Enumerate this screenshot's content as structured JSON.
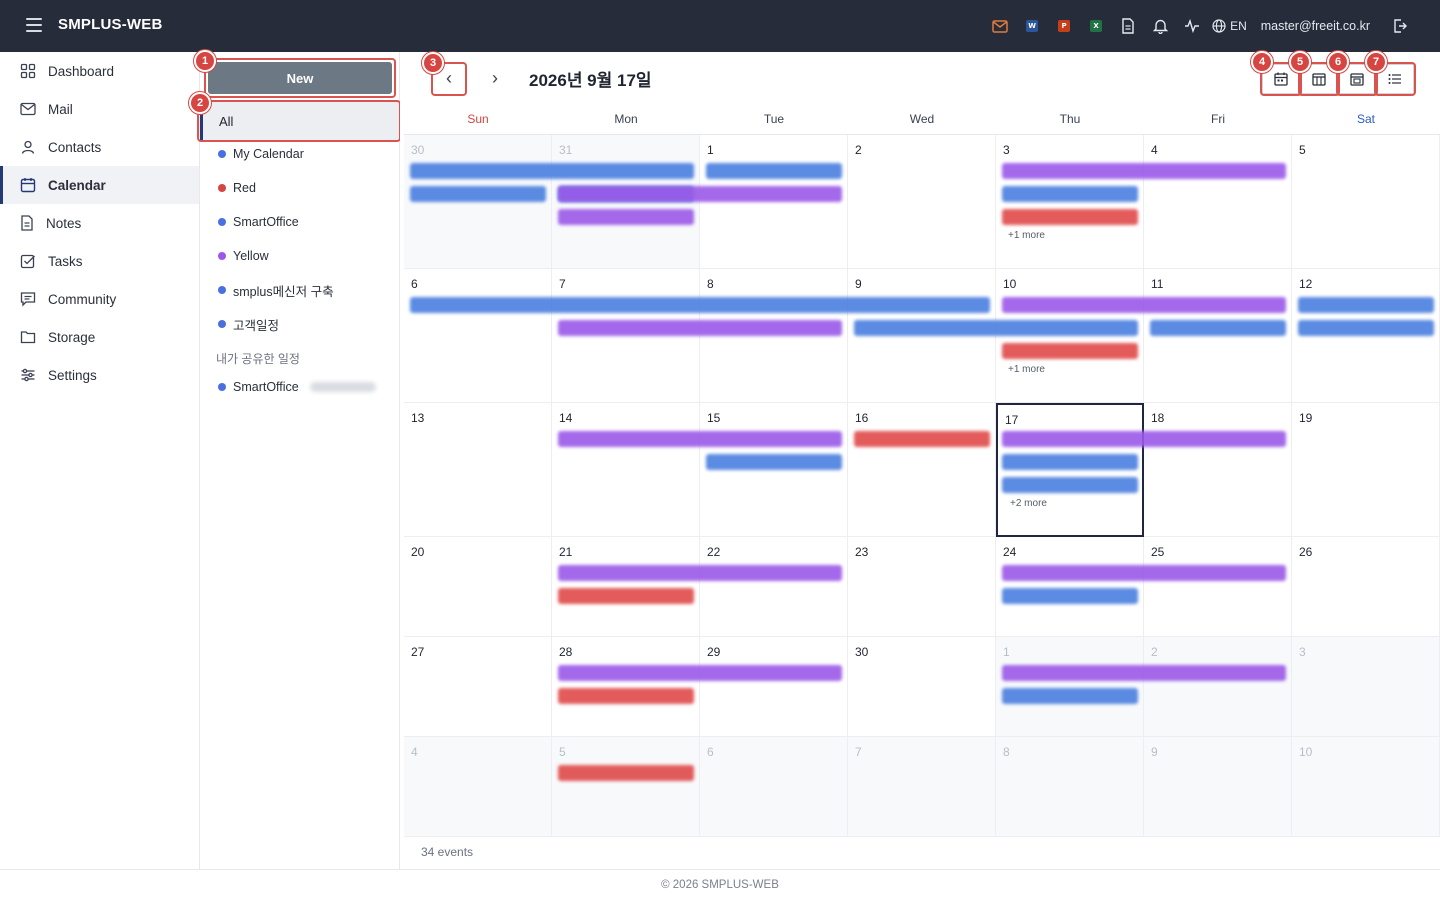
{
  "app": {
    "title": "SMPLUS-WEB"
  },
  "header": {
    "office_badges": {
      "word": "W",
      "powerpoint": "P",
      "excel": "X"
    },
    "language": "EN",
    "user_email": "master@freeit.co.kr",
    "colors": {
      "mail": "#e07a3c",
      "word": "#2b579a",
      "powerpoint": "#c43e1c",
      "excel": "#217346"
    }
  },
  "sidebar": {
    "items": [
      {
        "label": "Dashboard",
        "icon": "grid-icon"
      },
      {
        "label": "Mail",
        "icon": "mail-icon"
      },
      {
        "label": "Contacts",
        "icon": "contacts-icon"
      },
      {
        "label": "Calendar",
        "icon": "calendar-icon",
        "active": true
      },
      {
        "label": "Notes",
        "icon": "note-icon"
      },
      {
        "label": "Tasks",
        "icon": "check-square-icon"
      },
      {
        "label": "Community",
        "icon": "chat-icon"
      },
      {
        "label": "Storage",
        "icon": "folder-icon"
      },
      {
        "label": "Settings",
        "icon": "sliders-icon"
      }
    ]
  },
  "calendar_panel": {
    "new_label": "New",
    "all_label": "All",
    "calendars": [
      {
        "label": "My Calendar",
        "color": "#4a6fe0"
      },
      {
        "label": "Red",
        "color": "#d64541"
      },
      {
        "label": "SmartOffice",
        "color": "#4a6fe0"
      },
      {
        "label": "Yellow",
        "color": "#9b59e8"
      },
      {
        "label": "smplus메신저 구축",
        "color": "#4a6fe0"
      },
      {
        "label": "고객일정",
        "color": "#4a6fe0"
      }
    ],
    "shared_title": "내가 공유한 일정",
    "shared": [
      {
        "label": "SmartOffice",
        "color": "#4a6fe0"
      }
    ]
  },
  "annotations": [
    "1",
    "2",
    "3",
    "4",
    "5",
    "6",
    "7"
  ],
  "main": {
    "title": "2026년 9월 17일",
    "prev": "‹",
    "next": "›",
    "days_of_week": [
      "Sun",
      "Mon",
      "Tue",
      "Wed",
      "Thu",
      "Fri",
      "Sat"
    ],
    "weeks": [
      {
        "days": [
          {
            "d": "30",
            "other": true
          },
          {
            "d": "31",
            "other": true
          },
          {
            "d": "1"
          },
          {
            "d": "2"
          },
          {
            "d": "3",
            "more": "+1 more"
          },
          {
            "d": "4"
          },
          {
            "d": "5"
          }
        ]
      },
      {
        "days": [
          {
            "d": "6"
          },
          {
            "d": "7"
          },
          {
            "d": "8"
          },
          {
            "d": "9"
          },
          {
            "d": "10",
            "more": "+1 more"
          },
          {
            "d": "11"
          },
          {
            "d": "12"
          }
        ]
      },
      {
        "days": [
          {
            "d": "13"
          },
          {
            "d": "14"
          },
          {
            "d": "15"
          },
          {
            "d": "16"
          },
          {
            "d": "17",
            "today": true,
            "more": "+2 more"
          },
          {
            "d": "18"
          },
          {
            "d": "19"
          }
        ]
      },
      {
        "days": [
          {
            "d": "20"
          },
          {
            "d": "21"
          },
          {
            "d": "22"
          },
          {
            "d": "23"
          },
          {
            "d": "24"
          },
          {
            "d": "25"
          },
          {
            "d": "26"
          }
        ]
      },
      {
        "days": [
          {
            "d": "27"
          },
          {
            "d": "28"
          },
          {
            "d": "29"
          },
          {
            "d": "30"
          },
          {
            "d": "1",
            "other": true
          },
          {
            "d": "2",
            "other": true
          },
          {
            "d": "3",
            "other": true
          }
        ]
      },
      {
        "days": [
          {
            "d": "4",
            "other": true
          },
          {
            "d": "5",
            "other": true
          },
          {
            "d": "6",
            "other": true
          },
          {
            "d": "7",
            "other": true
          },
          {
            "d": "8",
            "other": true
          },
          {
            "d": "9",
            "other": true
          },
          {
            "d": "10",
            "other": true
          }
        ]
      }
    ],
    "events": [
      {
        "week": 0,
        "start": 0,
        "span": 2,
        "lane": 0,
        "color": "blue"
      },
      {
        "week": 0,
        "start": 0,
        "span": 1,
        "lane": 1,
        "color": "blue"
      },
      {
        "week": 0,
        "start": 1,
        "span": 1,
        "lane": 1,
        "color": "blue"
      },
      {
        "week": 0,
        "start": 1,
        "span": 1,
        "lane": 2,
        "color": "purple"
      },
      {
        "week": 0,
        "start": 2,
        "span": 1,
        "lane": 0,
        "color": "blue"
      },
      {
        "week": 0,
        "start": 1,
        "span": 2,
        "lane": 1,
        "color": "purple"
      },
      {
        "week": 0,
        "start": 4,
        "span": 2,
        "lane": 0,
        "color": "purple"
      },
      {
        "week": 0,
        "start": 4,
        "span": 1,
        "lane": 1,
        "color": "blue"
      },
      {
        "week": 0,
        "start": 4,
        "span": 1,
        "lane": 2,
        "color": "red"
      },
      {
        "week": 1,
        "start": 0,
        "span": 4,
        "lane": 0,
        "color": "blue"
      },
      {
        "week": 1,
        "start": 1,
        "span": 2,
        "lane": 1,
        "color": "purple"
      },
      {
        "week": 1,
        "start": 3,
        "span": 2,
        "lane": 1,
        "color": "blue"
      },
      {
        "week": 1,
        "start": 4,
        "span": 2,
        "lane": 0,
        "color": "purple"
      },
      {
        "week": 1,
        "start": 5,
        "span": 1,
        "lane": 1,
        "color": "blue"
      },
      {
        "week": 1,
        "start": 4,
        "span": 1,
        "lane": 2,
        "color": "red"
      },
      {
        "week": 1,
        "start": 6,
        "span": 1,
        "lane": 0,
        "color": "blue"
      },
      {
        "week": 1,
        "start": 6,
        "span": 1,
        "lane": 1,
        "color": "blue"
      },
      {
        "week": 2,
        "start": 1,
        "span": 2,
        "lane": 0,
        "color": "purple"
      },
      {
        "week": 2,
        "start": 2,
        "span": 1,
        "lane": 1,
        "color": "blue"
      },
      {
        "week": 2,
        "start": 3,
        "span": 1,
        "lane": 0,
        "color": "red"
      },
      {
        "week": 2,
        "start": 4,
        "span": 2,
        "lane": 0,
        "color": "purple"
      },
      {
        "week": 2,
        "start": 4,
        "span": 1,
        "lane": 1,
        "color": "blue"
      },
      {
        "week": 2,
        "start": 4,
        "span": 1,
        "lane": 2,
        "color": "blue"
      },
      {
        "week": 3,
        "start": 1,
        "span": 2,
        "lane": 0,
        "color": "purple"
      },
      {
        "week": 3,
        "start": 1,
        "span": 1,
        "lane": 1,
        "color": "red"
      },
      {
        "week": 3,
        "start": 4,
        "span": 2,
        "lane": 0,
        "color": "purple"
      },
      {
        "week": 3,
        "start": 4,
        "span": 1,
        "lane": 1,
        "color": "blue"
      },
      {
        "week": 4,
        "start": 1,
        "span": 2,
        "lane": 0,
        "color": "purple"
      },
      {
        "week": 4,
        "start": 1,
        "span": 1,
        "lane": 1,
        "color": "red"
      },
      {
        "week": 4,
        "start": 4,
        "span": 2,
        "lane": 0,
        "color": "purple"
      },
      {
        "week": 4,
        "start": 4,
        "span": 1,
        "lane": 1,
        "color": "blue"
      },
      {
        "week": 5,
        "start": 1,
        "span": 1,
        "lane": 0,
        "color": "red"
      }
    ],
    "event_count": "34 events"
  },
  "footer": {
    "copyright": "© 2026 SMPLUS-WEB"
  }
}
